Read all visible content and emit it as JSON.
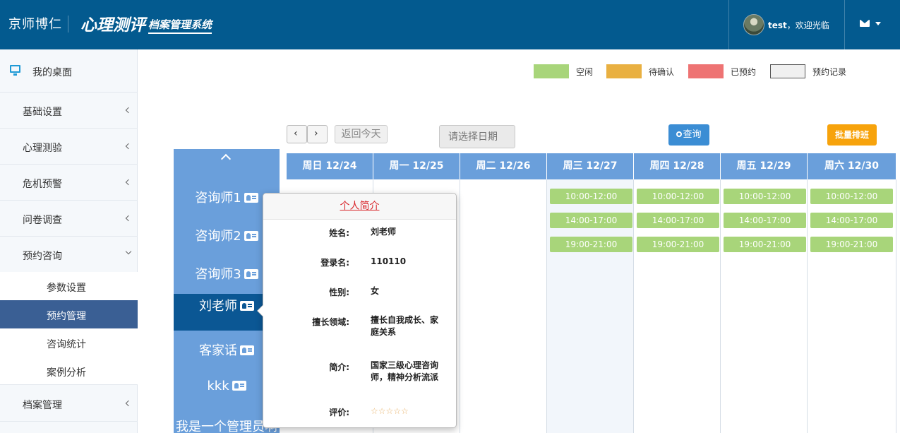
{
  "header": {
    "brand": "京师博仁",
    "product": "心理测评",
    "product_sub": "档案管理系统",
    "user_name": "test",
    "user_greeting": "，欢迎光临"
  },
  "sidebar": {
    "desktop": "我的桌面",
    "items": [
      "基础设置",
      "心理测验",
      "危机预警",
      "问卷调查",
      "预约咨询"
    ],
    "subitems": [
      "参数设置",
      "预约管理",
      "咨询统计",
      "案例分析"
    ],
    "archive": "档案管理"
  },
  "legend": [
    {
      "label": "空闲",
      "color": "#a8d57a"
    },
    {
      "label": "待确认",
      "color": "#e9b041"
    },
    {
      "label": "已预约",
      "color": "#ee7373"
    },
    {
      "label": "预约记录",
      "color": "#f0f0f0"
    }
  ],
  "toolbar": {
    "prev": "‹",
    "next": "›",
    "today": "返回今天",
    "date_placeholder": "请选择日期",
    "query": "查询",
    "batch": "批量排班"
  },
  "counselors": [
    "咨询师1",
    "咨询师2",
    "咨询师3",
    "刘老师",
    "客家话",
    "kkk",
    "我是一个管理员啊"
  ],
  "calendar": {
    "days": [
      "周日 12/24",
      "周一 12/25",
      "周二 12/26",
      "周三 12/27",
      "周四 12/28",
      "周五 12/29",
      "周六 12/30"
    ],
    "slots": [
      "10:00-12:00",
      "14:00-17:00",
      "19:00-21:00"
    ]
  },
  "popover": {
    "title": "个人简介",
    "fields": [
      {
        "key": "姓名:",
        "value": "刘老师"
      },
      {
        "key": "登录名:",
        "value": "110110"
      },
      {
        "key": "性别:",
        "value": "女"
      },
      {
        "key": "擅长领域:",
        "value": "擅长自我成长、家庭关系"
      },
      {
        "key": "简介:",
        "value": "国家三级心理咨询师，精神分析流派"
      },
      {
        "key": "评价:",
        "value": "☆☆☆☆☆"
      }
    ]
  }
}
